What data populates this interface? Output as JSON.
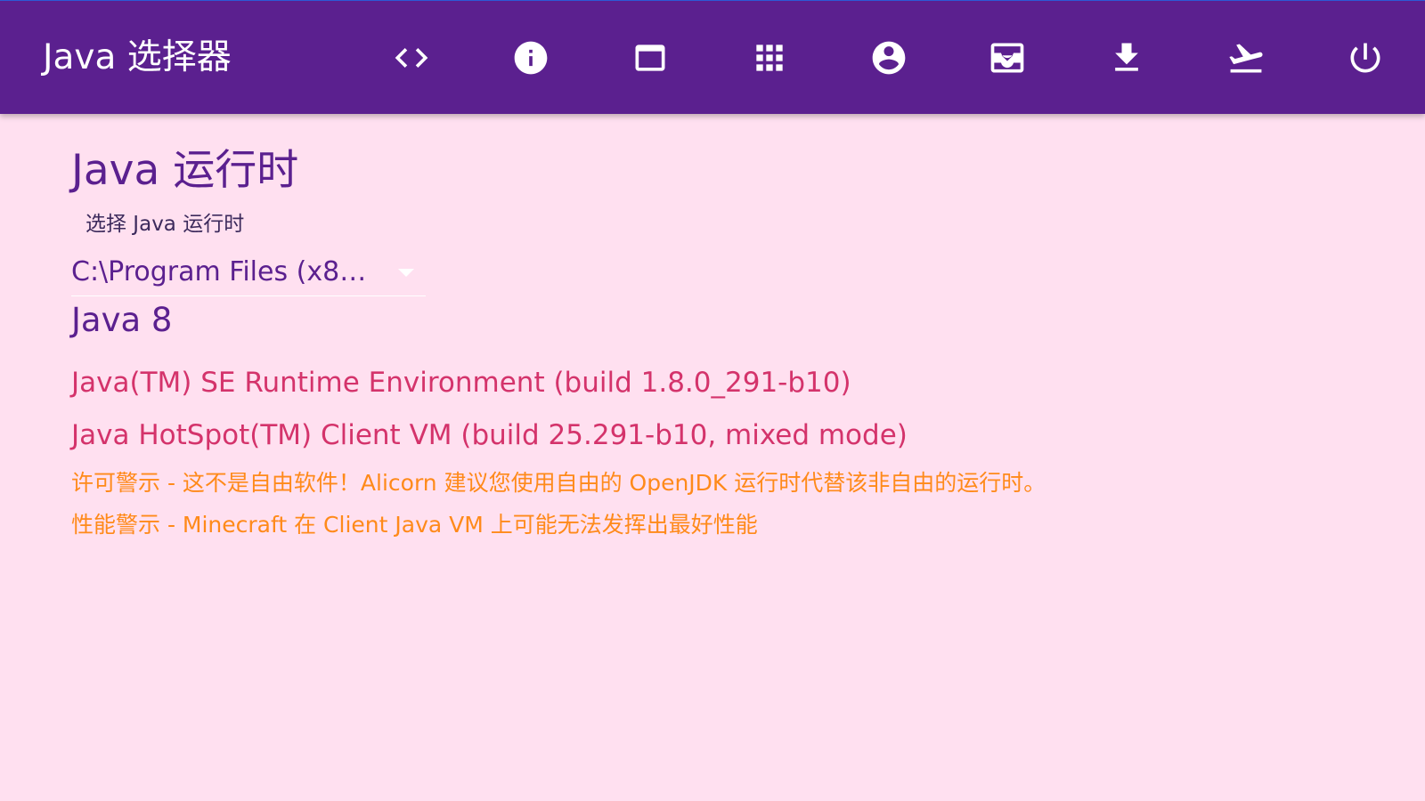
{
  "header": {
    "title": "Java 选择器",
    "icons": [
      {
        "name": "code-icon"
      },
      {
        "name": "info-icon"
      },
      {
        "name": "window-icon"
      },
      {
        "name": "apps-grid-icon"
      },
      {
        "name": "account-circle-icon"
      },
      {
        "name": "inbox-icon"
      },
      {
        "name": "download-icon"
      },
      {
        "name": "flight-takeoff-icon"
      },
      {
        "name": "power-icon"
      }
    ],
    "colors": {
      "bar": "#5b208f",
      "icon": "#ffffff"
    }
  },
  "main": {
    "title": "Java 运行时",
    "select": {
      "label": "选择 Java 运行时",
      "value": "C:\\Program Files (x86..."
    },
    "version_heading": "Java 8",
    "runtime_info": [
      "Java(TM) SE Runtime Environment (build 1.8.0_291-b10)",
      "Java HotSpot(TM) Client VM (build 25.291-b10, mixed mode)"
    ],
    "warnings": [
      "许可警示 - 这不是自由软件！Alicorn 建议您使用自由的 OpenJDK 运行时代替该非自由的运行时。",
      "性能警示 - Minecraft 在 Client Java VM 上可能无法发挥出最好性能"
    ],
    "colors": {
      "background": "#ffe0f0",
      "info": "#d4336b",
      "warning": "#ff8a1a"
    }
  }
}
